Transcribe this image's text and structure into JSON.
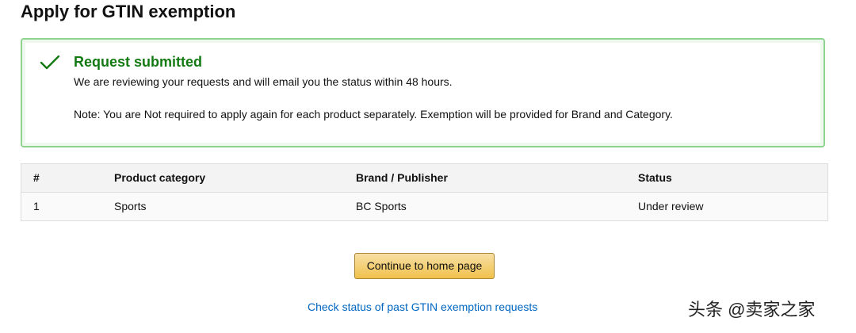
{
  "header": {
    "title": "Apply for GTIN exemption"
  },
  "alert": {
    "icon": "checkmark-icon",
    "heading": "Request submitted",
    "message": "We are reviewing your requests and will email you the status within 48 hours.",
    "note": "Note: You are Not required to apply again for each product separately. Exemption will be provided for Brand and Category.",
    "heading_color": "#137a13",
    "border_color": "#8ed38e"
  },
  "table": {
    "columns": [
      "#",
      "Product category",
      "Brand / Publisher",
      "Status"
    ],
    "rows": [
      [
        "1",
        "Sports",
        "BC Sports",
        "Under review"
      ]
    ]
  },
  "actions": {
    "continue_label": "Continue to home page",
    "status_link_label": "Check status of past GTIN exemption requests",
    "link_color": "#0066c0"
  },
  "watermark": {
    "text": "头条 @卖家之家"
  }
}
